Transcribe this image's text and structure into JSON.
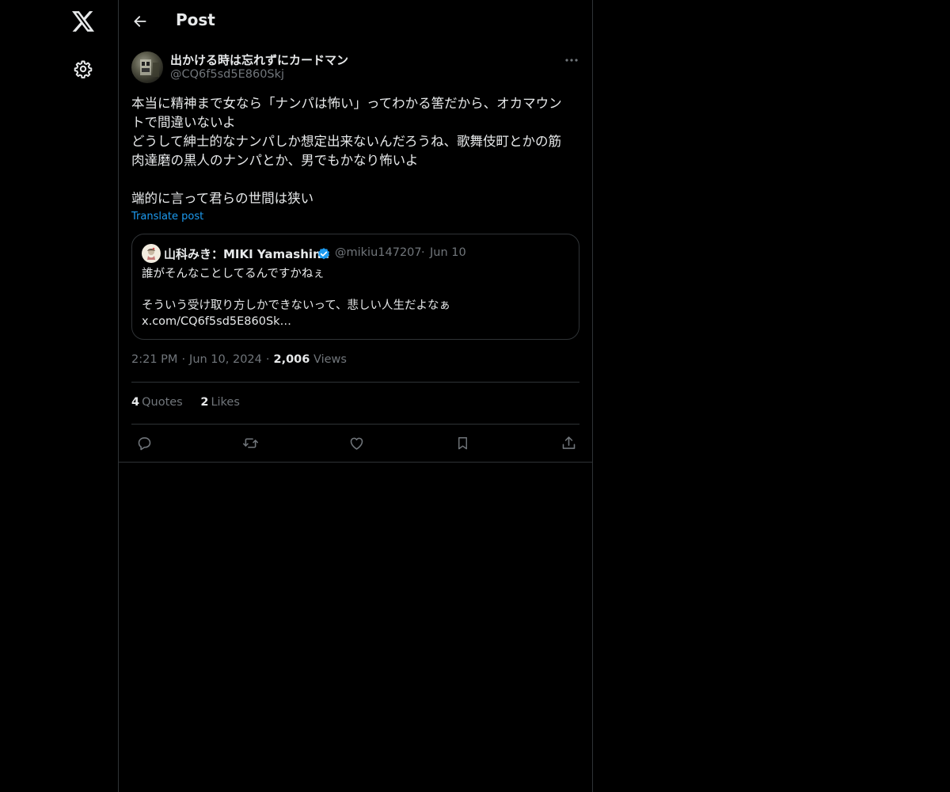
{
  "header": {
    "title": "Post"
  },
  "post": {
    "author_name": "出かける時は忘れずにカードマン",
    "author_handle": "@CQ6f5sd5E860Skj",
    "text_lines": [
      "本当に精神まで女なら「ナンパは怖い」ってわかる筈だから、オカマウン",
      "トで間違いないよ",
      "どうして紳士的なナンパしか想定出来ないんだろうね、歌舞伎町とかの筋",
      "肉達磨の黒人のナンパとか、男でもかなり怖いよ",
      "",
      "端的に言って君らの世間は狭い"
    ],
    "translate_label": "Translate post",
    "time": "2:21 PM",
    "date": "Jun 10, 2024",
    "views_count": "2,006",
    "views_label": "Views"
  },
  "quote": {
    "author_name": "山科みき：MIKI Yamashina",
    "author_handle": "@mikiu147207",
    "date": "Jun 10",
    "text_lines": [
      "誰がそんなことしてるんですかねぇ",
      "",
      "そういう受け取り方しかできないって、悲しい人生だよなぁ",
      "x.com/CQ6f5sd5E860Sk…"
    ]
  },
  "stats": {
    "quotes_count": "4",
    "quotes_label": "Quotes",
    "likes_count": "2",
    "likes_label": "Likes"
  },
  "colors": {
    "background": "#000000",
    "text": "#e7e9ea",
    "muted": "#71767b",
    "accent": "#1d9bf0",
    "border": "#2f3336"
  },
  "icons": {
    "logo": "x-logo-icon",
    "settings": "gear-icon",
    "back": "arrow-left-icon",
    "more": "more-icon",
    "verified": "verified-badge-icon",
    "reply": "reply-icon",
    "repost": "repost-icon",
    "like": "heart-icon",
    "bookmark": "bookmark-icon",
    "share": "share-icon"
  }
}
